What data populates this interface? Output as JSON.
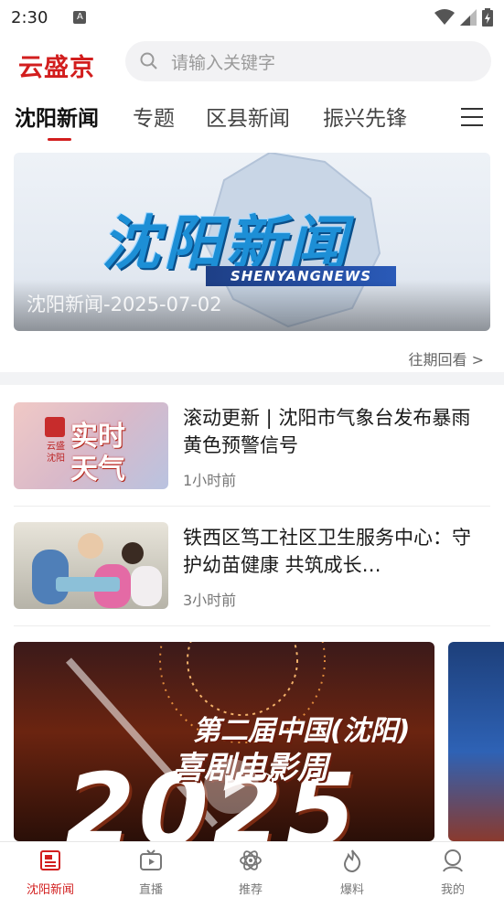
{
  "status_bar": {
    "time": "2:30",
    "notification_icon": "A"
  },
  "header": {
    "logo": "云盛京",
    "search_placeholder": "请输入关键字"
  },
  "tabs": [
    "沈阳新闻",
    "专题",
    "区县新闻",
    "振兴先锋"
  ],
  "active_tab": "沈阳新闻",
  "banner": {
    "title_art": "沈阳新闻",
    "subtitle_art": "SHENYANGNEWS",
    "caption": "沈阳新闻-2025-07-02",
    "past_link": "往期回看 >"
  },
  "news": [
    {
      "title": "滚动更新 | 沈阳市气象台发布暴雨黄色预警信号",
      "time": "1小时前",
      "thumb_text_1": "实时",
      "thumb_text_2": "天气",
      "thumb_side": "云盛沈阳"
    },
    {
      "title": "铁西区笃工社区卫生服务中心：守护幼苗健康 共筑成长…",
      "time": "3小时前"
    }
  ],
  "feature": {
    "line1": "第二届中国(沈阳)",
    "line2": "喜剧电影周",
    "year": "2025"
  },
  "bottom_nav": [
    {
      "label": "沈阳新闻",
      "icon": "news-icon",
      "active": true
    },
    {
      "label": "直播",
      "icon": "tv-icon",
      "active": false
    },
    {
      "label": "推荐",
      "icon": "atom-icon",
      "active": false
    },
    {
      "label": "爆料",
      "icon": "fire-icon",
      "active": false
    },
    {
      "label": "我的",
      "icon": "user-icon",
      "active": false
    }
  ],
  "colors": {
    "accent": "#d21e1e"
  }
}
